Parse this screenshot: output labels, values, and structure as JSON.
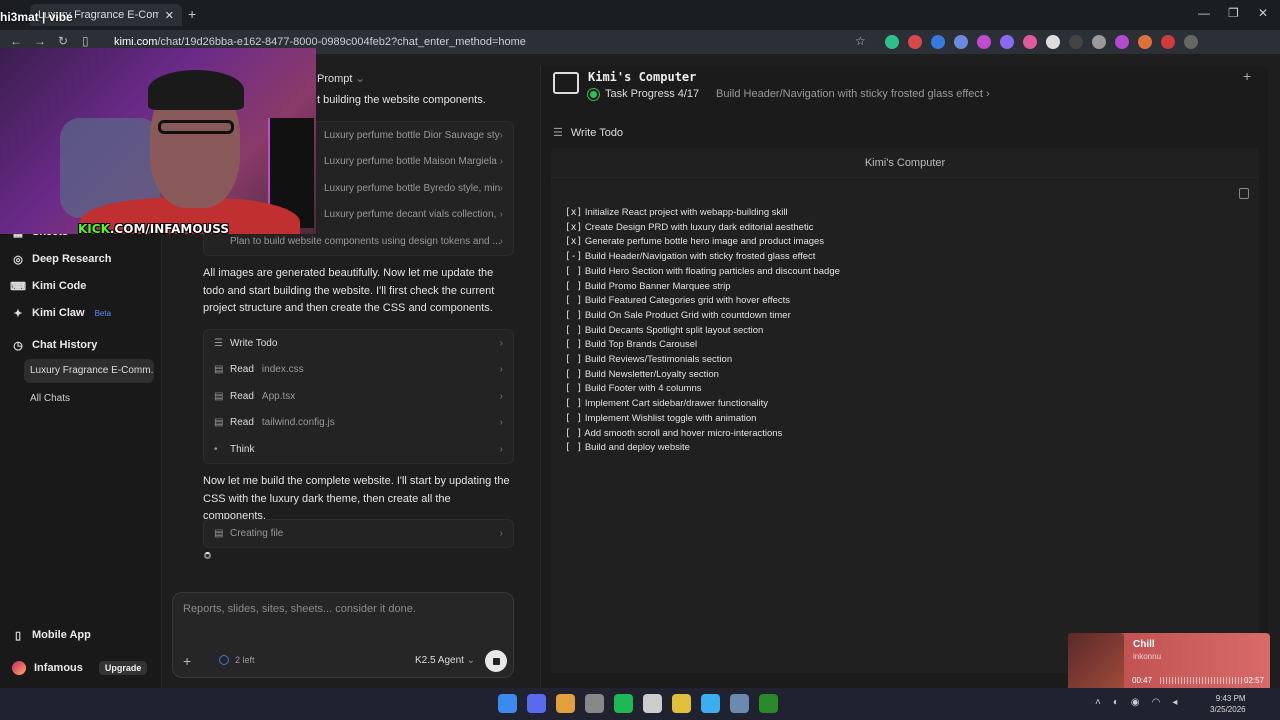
{
  "browser": {
    "tab_title": "Luxury Fragrance E-Commerce",
    "url_host": "kimi.com",
    "url_path": "/chat/19d26bba-e162-8477-8000-0989c004feb2?chat_enter_method=home"
  },
  "stream": {
    "name": "hi3mat | vibe",
    "kick_brand": "KICK",
    "kick_url": ".COM/INFAMOUSS"
  },
  "sidebar": {
    "items": [
      {
        "label": "Sheets",
        "icon": "grid-icon"
      },
      {
        "label": "Deep Research",
        "icon": "globe-icon"
      },
      {
        "label": "Kimi Code",
        "icon": "code-icon"
      },
      {
        "label": "Kimi Claw",
        "icon": "claw-icon",
        "badge": "Beta"
      },
      {
        "label": "Chat History",
        "icon": "clock-icon"
      }
    ],
    "active_chat": "Luxury Fragrance E-Comm...",
    "all_chats": "All Chats",
    "mobile_app": "Mobile App",
    "user_name": "Infamous",
    "upgrade": "Upgrade"
  },
  "chat": {
    "prompt_label": "Prompt",
    "top_text": "t building the website components.",
    "image_tasks": [
      "Luxury perfume bottle Dior Sauvage styl...",
      "Luxury perfume bottle Maison Margiela ...",
      "Luxury perfume bottle Byredo style, min...",
      "Luxury perfume decant vials collection, ...",
      "Plan to build website components using design tokens and ..."
    ],
    "message1": "All images are generated beautifully. Now let me update the todo and start building the website. I'll first check the current project structure and then create the CSS and components.",
    "tool_steps": [
      {
        "action": "Write Todo",
        "file": ""
      },
      {
        "action": "Read",
        "file": "index.css"
      },
      {
        "action": "Read",
        "file": "App.tsx"
      },
      {
        "action": "Read",
        "file": "tailwind.config.js"
      },
      {
        "action": "Think",
        "file": ""
      }
    ],
    "message2": "Now let me build the complete website. I'll start by updating the CSS with the luxury dark theme, then create all the components.",
    "creating_file": "Creating file",
    "input_placeholder": "Reports, slides, sites, sheets... consider it done.",
    "quota": "2 left",
    "agent": "K2.5 Agent"
  },
  "computer": {
    "title": "Kimi's Computer",
    "task_progress": "Task Progress 4/17",
    "current_step": "Build Header/Navigation with sticky frosted glass effect",
    "write_todo": "Write Todo",
    "panel_title": "Kimi's Computer",
    "todos": [
      {
        "mark": "[x]",
        "text": "Initialize React project with webapp-building skill"
      },
      {
        "mark": "[x]",
        "text": "Create Design PRD with luxury dark editorial aesthetic"
      },
      {
        "mark": "[x]",
        "text": "Generate perfume bottle hero image and product images"
      },
      {
        "mark": "[-]",
        "text": "Build Header/Navigation with sticky frosted glass effect"
      },
      {
        "mark": "[ ]",
        "text": "Build Hero Section with floating particles and discount badge"
      },
      {
        "mark": "[ ]",
        "text": "Build Promo Banner Marquee strip"
      },
      {
        "mark": "[ ]",
        "text": "Build Featured Categories grid with hover effects"
      },
      {
        "mark": "[ ]",
        "text": "Build On Sale Product Grid with countdown timer"
      },
      {
        "mark": "[ ]",
        "text": "Build Decants Spotlight split layout section"
      },
      {
        "mark": "[ ]",
        "text": "Build Top Brands Carousel"
      },
      {
        "mark": "[ ]",
        "text": "Build Reviews/Testimonials section"
      },
      {
        "mark": "[ ]",
        "text": "Build Newsletter/Loyalty section"
      },
      {
        "mark": "[ ]",
        "text": "Build Footer with 4 columns"
      },
      {
        "mark": "[ ]",
        "text": "Implement Cart sidebar/drawer functionality"
      },
      {
        "mark": "[ ]",
        "text": "Implement Wishlist toggle with animation"
      },
      {
        "mark": "[ ]",
        "text": "Add smooth scroll and hover micro-interactions"
      },
      {
        "mark": "[ ]",
        "text": "Build and deploy website"
      }
    ]
  },
  "music": {
    "song": "Chill",
    "artist": "inkonnu",
    "elapsed": "00:47",
    "duration": "02:57"
  },
  "taskbar": {
    "time": "9:43 PM",
    "date": "3/25/2026"
  },
  "colors": {
    "accent_green": "#2fbf5a",
    "kick_green": "#53fc18",
    "beta_blue": "#5b8cff"
  }
}
